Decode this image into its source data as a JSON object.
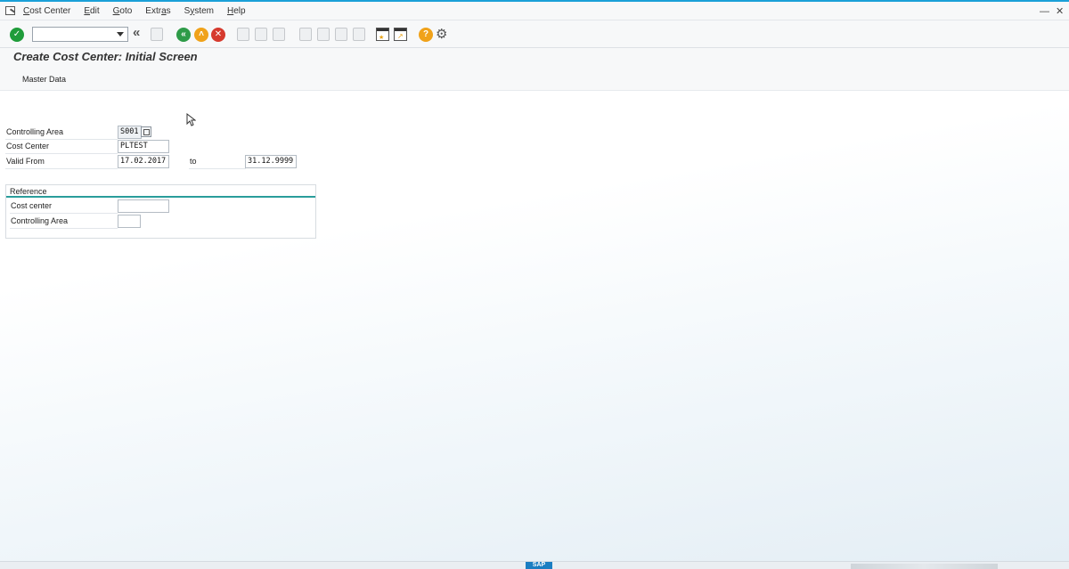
{
  "menu": {
    "items": [
      {
        "pre": "",
        "u": "C",
        "post": "ost Center"
      },
      {
        "pre": "",
        "u": "E",
        "post": "dit"
      },
      {
        "pre": "",
        "u": "G",
        "post": "oto"
      },
      {
        "pre": "Extr",
        "u": "a",
        "post": "s"
      },
      {
        "pre": "S",
        "u": "y",
        "post": "stem"
      },
      {
        "pre": "",
        "u": "H",
        "post": "elp"
      }
    ]
  },
  "toolbar": {
    "command_field_value": "",
    "icons": [
      "enter-icon",
      "back-double-arrow-icon",
      "save-icon",
      "back-icon",
      "exit-icon",
      "cancel-icon",
      "print-icon",
      "find-icon",
      "find-next-icon",
      "first-page-icon",
      "previous-page-icon",
      "next-page-icon",
      "last-page-icon",
      "create-session-icon",
      "shortcut-icon",
      "help-icon",
      "customize-layout-icon"
    ]
  },
  "page": {
    "title": "Create Cost Center: Initial Screen",
    "app_toolbar_button": "Master Data"
  },
  "form": {
    "controlling_area_label": "Controlling Area",
    "controlling_area_value": "S001",
    "cost_center_label": "Cost Center",
    "cost_center_value": "PLTEST",
    "valid_from_label": "Valid From",
    "valid_from_value": "17.02.2017",
    "to_label": "to",
    "valid_to_value": "31.12.9999"
  },
  "reference": {
    "title": "Reference",
    "cost_center_label": "Cost center",
    "cost_center_value": "",
    "controlling_area_label": "Controlling Area",
    "controlling_area_value": ""
  },
  "statusbar": {
    "logo": "SAP"
  },
  "colors": {
    "accent": "#1aa0d8",
    "group_line": "#2a9d9b",
    "enter_green": "#1f9c3a",
    "nav_green": "#2e9b48",
    "nav_orange": "#f0a21a",
    "cancel_red": "#d63a2e",
    "help_orange": "#f0a21a"
  }
}
